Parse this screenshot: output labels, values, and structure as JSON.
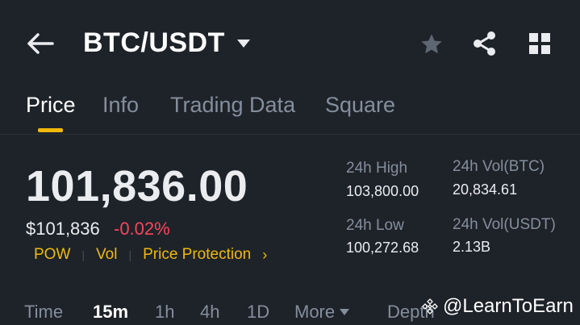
{
  "header": {
    "pair": "BTC/USDT",
    "icons": [
      "back-arrow-icon",
      "dropdown-caret-icon",
      "star-icon",
      "share-icon",
      "grid-icon"
    ]
  },
  "tabs": [
    {
      "label": "Price",
      "active": true
    },
    {
      "label": "Info",
      "active": false
    },
    {
      "label": "Trading Data",
      "active": false
    },
    {
      "label": "Square",
      "active": false
    }
  ],
  "price": {
    "last": "101,836.00",
    "usd": "$101,836",
    "change": "-0.02%"
  },
  "tags": [
    "POW",
    "Vol",
    "Price Protection"
  ],
  "stats": {
    "high_label": "24h High",
    "high_value": "103,800.00",
    "vol_btc_label": "24h Vol(BTC)",
    "vol_btc_value": "20,834.61",
    "low_label": "24h Low",
    "low_value": "100,272.68",
    "vol_usdt_label": "24h Vol(USDT)",
    "vol_usdt_value": "2.13B"
  },
  "intervals": [
    {
      "label": "Time",
      "active": false
    },
    {
      "label": "15m",
      "active": true
    },
    {
      "label": "1h",
      "active": false
    },
    {
      "label": "4h",
      "active": false
    },
    {
      "label": "1D",
      "active": false
    },
    {
      "label": "More",
      "active": false
    },
    {
      "label": "Depth",
      "active": false
    }
  ],
  "watermark": "@LearnToEarn",
  "colors": {
    "background": "#1e2329",
    "accent": "#f0b90b",
    "negative": "#f6465d",
    "muted": "#848e9c"
  }
}
